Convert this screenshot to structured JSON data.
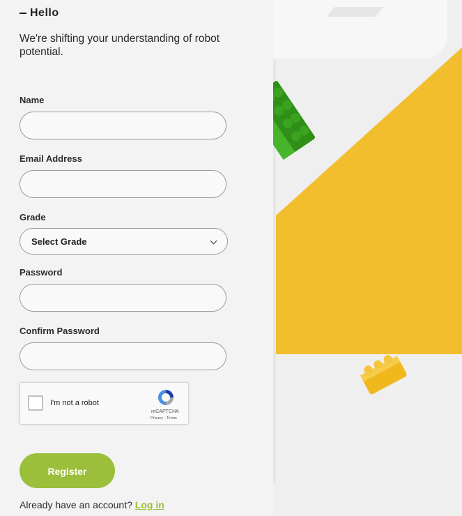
{
  "header": {
    "greeting": "Hello",
    "tagline": "We're shifting your understanding of robot potential."
  },
  "form": {
    "name_label": "Name",
    "name_value": "",
    "email_label": "Email Address",
    "email_value": "",
    "grade_label": "Grade",
    "grade_selected": "Select Grade",
    "password_label": "Password",
    "password_value": "",
    "confirm_label": "Confirm Password",
    "confirm_value": "",
    "captcha": {
      "label": "I'm not a robot",
      "brand": "reCAPTCHA",
      "links": "Privacy - Terms",
      "checked": false
    },
    "register_label": "Register"
  },
  "footer": {
    "prompt": "Already have an account? ",
    "login_label": "Log in"
  },
  "colors": {
    "accent": "#9bbf3a",
    "background": "#f3f3f3",
    "art_yellow": "#f2be2e",
    "art_green": "#3aa31f"
  },
  "icons": [
    "green-lego-brick-icon",
    "yellow-lego-brick-icon",
    "recaptcha-logo-icon",
    "chevron-down-icon"
  ]
}
